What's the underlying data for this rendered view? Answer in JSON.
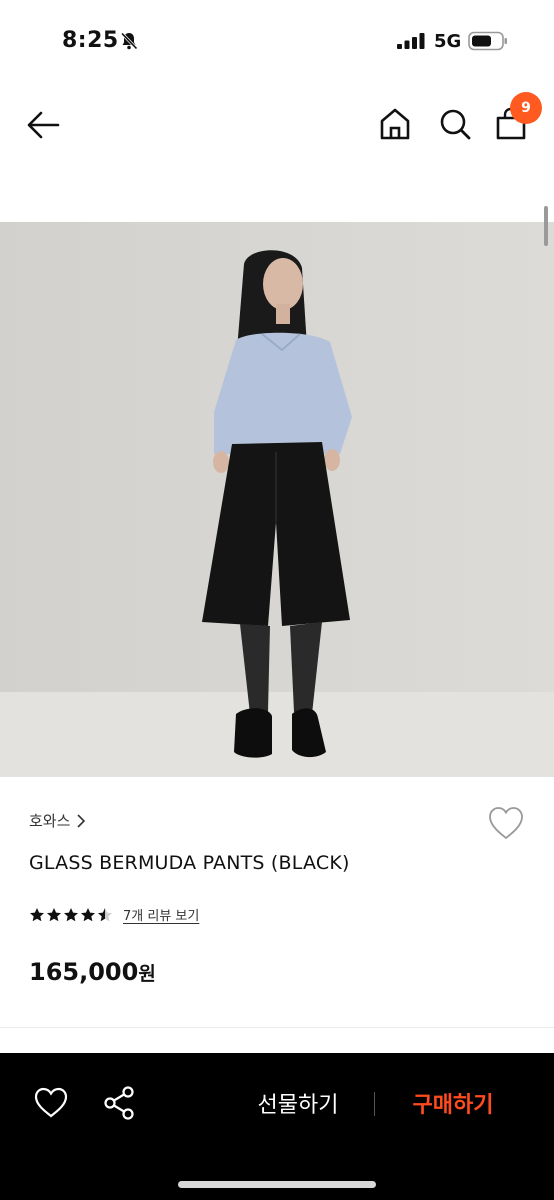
{
  "status": {
    "time": "8:25",
    "network": "5G",
    "icons": [
      "bell-slash-icon",
      "signal-icon",
      "battery-icon"
    ]
  },
  "nav": {
    "icons": [
      "back-arrow-icon",
      "home-icon",
      "search-icon",
      "shopping-bag-icon"
    ],
    "cart_count": "9"
  },
  "product": {
    "image": "model-in-black-bermuda-shorts",
    "brand": "호와스",
    "name": "GLASS BERMUDA PANTS (BLACK)",
    "rating": 4.5,
    "rating_max": 5,
    "review_link": "7개 리뷰 보기",
    "price": "165,000",
    "currency": "원"
  },
  "actions": {
    "gift_label": "선물하기",
    "buy_label": "구매하기"
  },
  "colors": {
    "accent": "#ff5a1f",
    "buy_text": "#ff4b1f",
    "action_bar": "#000000",
    "photo_bg": "#d9d7d3"
  }
}
